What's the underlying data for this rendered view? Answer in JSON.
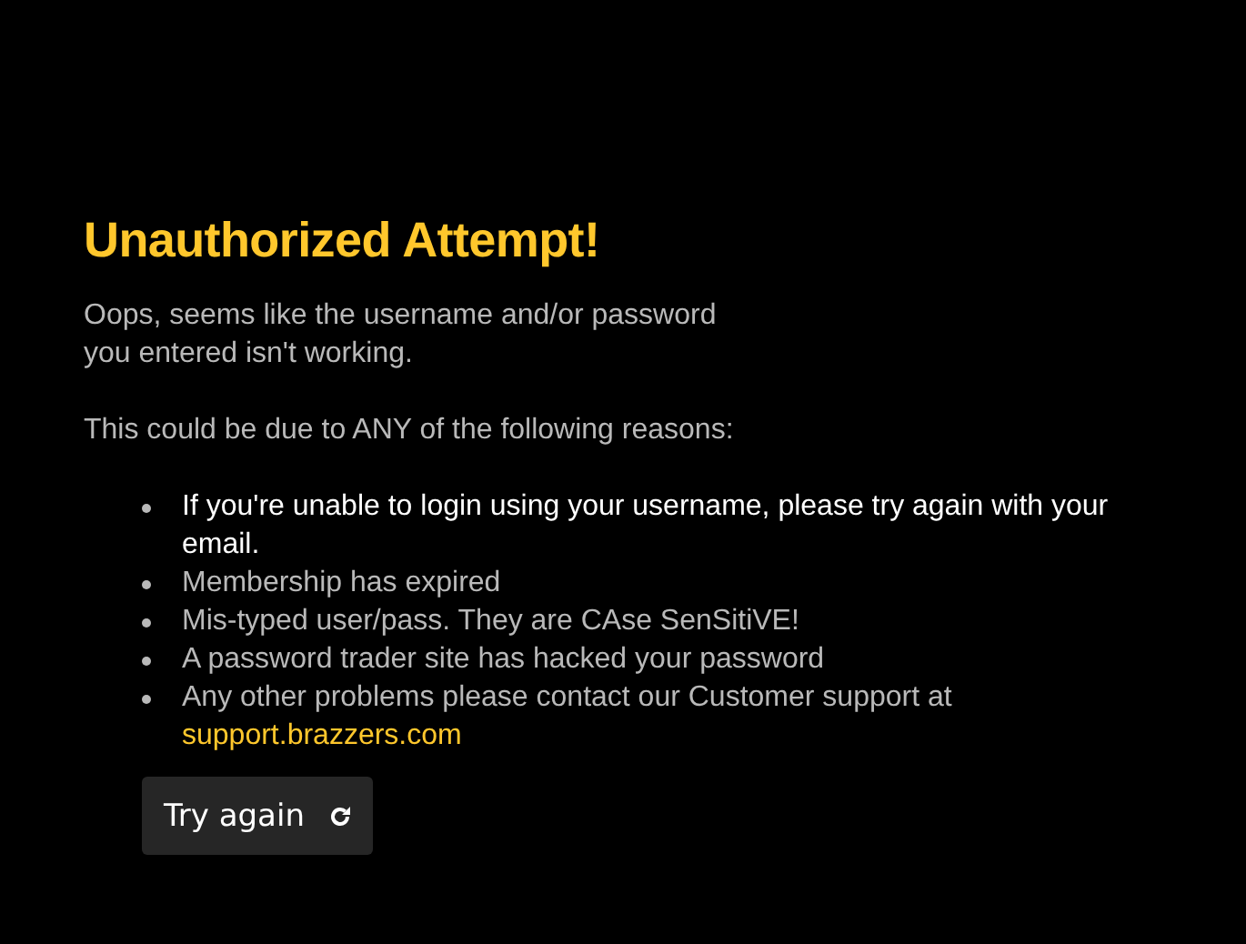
{
  "title": "Unauthorized Attempt!",
  "intro_lines": [
    "Oops, seems like the username and/or password",
    "you entered isn't working."
  ],
  "reasons_heading": "This could be due to ANY of the following reasons:",
  "reasons": [
    {
      "text": "If you're unable to login using your username, please try again with your email.",
      "emphasized": true
    },
    {
      "text": "Membership has expired",
      "emphasized": false
    },
    {
      "text": "Mis-typed user/pass. They are CAse SenSitiVE!",
      "emphasized": false
    },
    {
      "text": "A password trader site has hacked your password",
      "emphasized": false
    },
    {
      "text": "Any other problems please contact our Customer support at",
      "emphasized": false,
      "link": "support.brazzers.com"
    }
  ],
  "button": {
    "label": "Try again"
  }
}
